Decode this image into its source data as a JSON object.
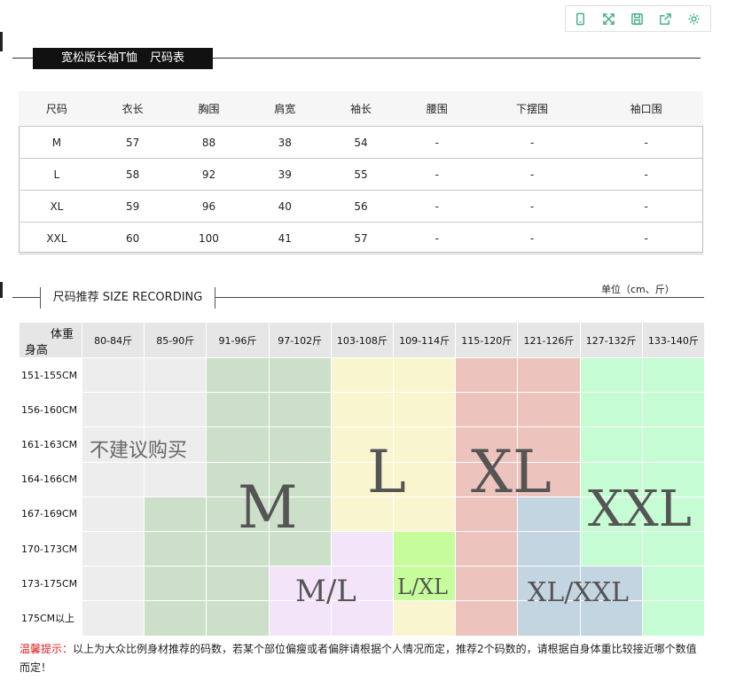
{
  "toolbar": {
    "icons": [
      "phone-icon",
      "expand-icon",
      "save-icon",
      "share-icon",
      "gear-icon"
    ]
  },
  "title": {
    "product": "宽松版长袖T恤",
    "chart": "尺码表"
  },
  "size_table": {
    "headers": [
      "尺码",
      "衣长",
      "胸围",
      "肩宽",
      "袖长",
      "腰围",
      "下摆围",
      "袖口围"
    ],
    "rows": [
      [
        "M",
        "57",
        "88",
        "38",
        "54",
        "-",
        "-",
        "-"
      ],
      [
        "L",
        "58",
        "92",
        "39",
        "55",
        "-",
        "-",
        "-"
      ],
      [
        "XL",
        "59",
        "96",
        "40",
        "56",
        "-",
        "-",
        "-"
      ],
      [
        "XXL",
        "60",
        "100",
        "41",
        "57",
        "-",
        "-",
        "-"
      ]
    ]
  },
  "recommend": {
    "title": "尺码推荐  SIZE RECORDING",
    "unit": "单位（cm、斤）",
    "corner_weight": "体重",
    "corner_height": "身高",
    "weights": [
      "80-84斤",
      "85-90斤",
      "91-96斤",
      "97-102斤",
      "103-108斤",
      "109-114斤",
      "115-120斤",
      "121-126斤",
      "127-132斤",
      "133-140斤"
    ],
    "heights": [
      "151-155CM",
      "156-160CM",
      "161-163CM",
      "164-166CM",
      "167-169CM",
      "170-173CM",
      "173-175CM",
      "175CM以上"
    ],
    "not_recommended": "不建议购买",
    "labels": {
      "m": "M",
      "l": "L",
      "xl": "XL",
      "xxl": "XXL",
      "ml": "M/L",
      "lxl": "L/XL",
      "xlxxl": "XL/XXL"
    },
    "colors": {
      "none": "#ededed",
      "m": "#ccdfc9",
      "l": "#f9f6cf",
      "xl": "#ecc4bd",
      "xxl": "#c5fcd4",
      "ml": "#f3e4f9",
      "lxl": "#c7fc9c",
      "xlxxl": "#c4d5e2"
    },
    "matrix": [
      [
        "none",
        "none",
        "m",
        "m",
        "l",
        "l",
        "xl",
        "xl",
        "xxl",
        "xxl"
      ],
      [
        "none",
        "none",
        "m",
        "m",
        "l",
        "l",
        "xl",
        "xl",
        "xxl",
        "xxl"
      ],
      [
        "none",
        "none",
        "m",
        "m",
        "l",
        "l",
        "xl",
        "xl",
        "xxl",
        "xxl"
      ],
      [
        "none",
        "none",
        "m",
        "m",
        "l",
        "l",
        "xl",
        "xl",
        "xxl",
        "xxl"
      ],
      [
        "none",
        "m",
        "m",
        "m",
        "l",
        "l",
        "xl",
        "xlxxl",
        "xxl",
        "xxl"
      ],
      [
        "none",
        "m",
        "m",
        "m",
        "ml",
        "lxl",
        "xl",
        "xlxxl",
        "xxl",
        "xxl"
      ],
      [
        "none",
        "m",
        "m",
        "ml",
        "ml",
        "lxl",
        "xl",
        "xlxxl",
        "xlxxl",
        "xxl"
      ],
      [
        "none",
        "m",
        "m",
        "ml",
        "ml",
        "l",
        "xl",
        "xlxxl",
        "xlxxl",
        "xxl"
      ]
    ]
  },
  "note": {
    "label": "温馨提示：",
    "text": "以上为大众比例身材推荐的码数，若某个部位偏瘦或者偏胖请根据个人情况而定，推荐2个码数的，请根据自身体重比较接近哪个数值而定！"
  }
}
